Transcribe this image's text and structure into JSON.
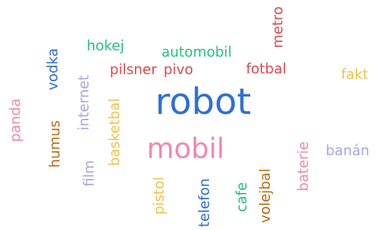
{
  "colors": {
    "blue": "#2f6fd6",
    "red": "#e5484d",
    "green": "#22c57a",
    "orange": "#c46a12",
    "yellow": "#f3c14b",
    "pink": "#f187ad",
    "lavender": "#a7a6e6"
  },
  "words": {
    "robot": "robot",
    "mobil": "mobil",
    "metro": "metro",
    "hokej": "hokej",
    "automobil": "automobil",
    "vodka": "vodka",
    "pilsner": "pilsner",
    "pivo": "pivo",
    "fotbal": "fotbal",
    "fakt": "fakt",
    "internet": "internet",
    "panda": "panda",
    "humus": "humus",
    "basketbal": "basketbal",
    "film": "film",
    "pistol": "pistol",
    "telefon": "telefon",
    "cafe": "cafe",
    "volejbal": "volejbal",
    "baterie": "baterie",
    "banan": "banán"
  }
}
